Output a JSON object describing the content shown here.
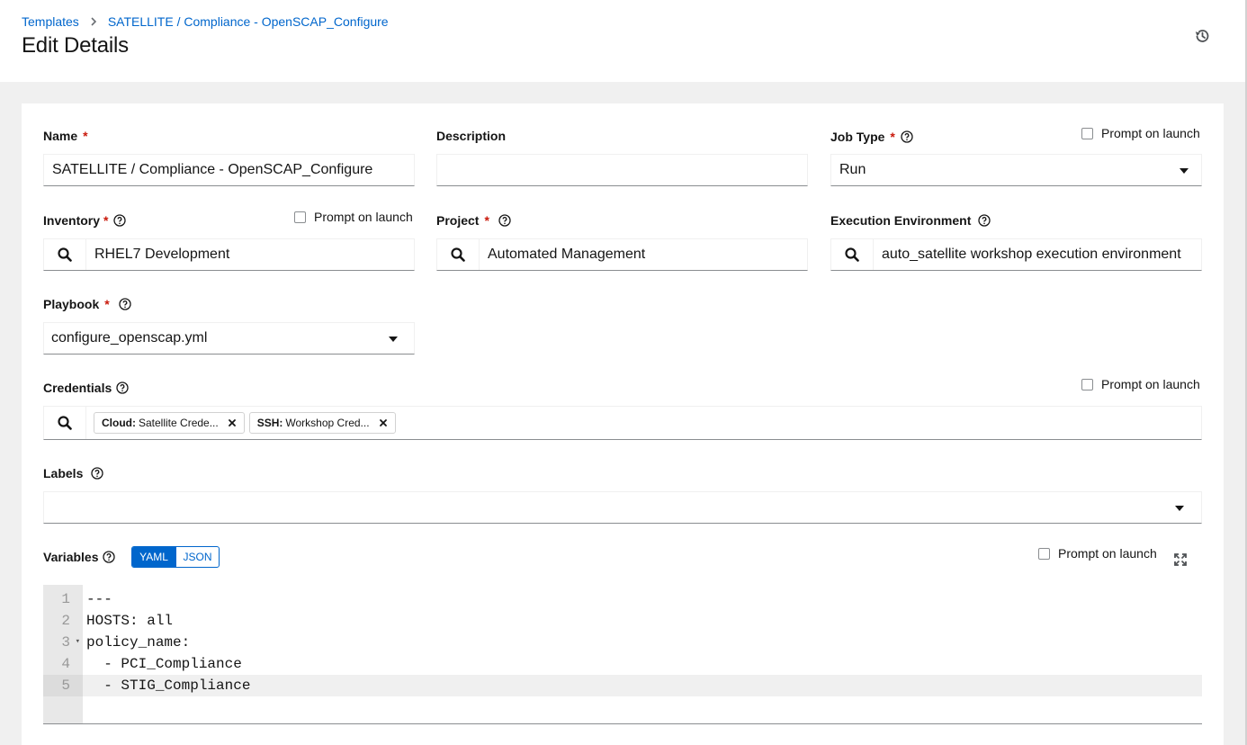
{
  "breadcrumb": {
    "templates": "Templates",
    "current": "SATELLITE / Compliance - OpenSCAP_Configure"
  },
  "page_title": "Edit Details",
  "form": {
    "name": {
      "label": "Name",
      "value": "SATELLITE / Compliance - OpenSCAP_Configure"
    },
    "description": {
      "label": "Description",
      "value": ""
    },
    "job_type": {
      "label": "Job Type",
      "value": "Run",
      "prompt": "Prompt on launch"
    },
    "inventory": {
      "label": "Inventory",
      "value": "RHEL7 Development",
      "prompt": "Prompt on launch"
    },
    "project": {
      "label": "Project",
      "value": "Automated Management"
    },
    "execution_environment": {
      "label": "Execution Environment",
      "value": "auto_satellite workshop execution environment"
    },
    "playbook": {
      "label": "Playbook",
      "value": "configure_openscap.yml"
    },
    "credentials": {
      "label": "Credentials",
      "prompt": "Prompt on launch",
      "chips": [
        {
          "type": "Cloud:",
          "name": "Satellite Crede..."
        },
        {
          "type": "SSH:",
          "name": "Workshop Cred..."
        }
      ]
    },
    "labels": {
      "label": "Labels",
      "value": ""
    },
    "variables": {
      "label": "Variables",
      "yaml": "YAML",
      "json": "JSON",
      "prompt": "Prompt on launch",
      "lines": [
        {
          "n": "1",
          "code": "---"
        },
        {
          "n": "2",
          "code": "HOSTS: all"
        },
        {
          "n": "3",
          "code": "policy_name:"
        },
        {
          "n": "4",
          "code": "  - PCI_Compliance"
        },
        {
          "n": "5",
          "code": "  - STIG_Compliance"
        }
      ]
    }
  },
  "colors": {
    "link": "#0066cc",
    "required": "#c9190b",
    "active_toggle": "#0066cc"
  },
  "icons": [
    "chevron-right-icon",
    "history-icon",
    "help-icon",
    "search-icon",
    "close-icon",
    "caret-down-icon",
    "expand-icon",
    "fold-arrow-icon"
  ]
}
